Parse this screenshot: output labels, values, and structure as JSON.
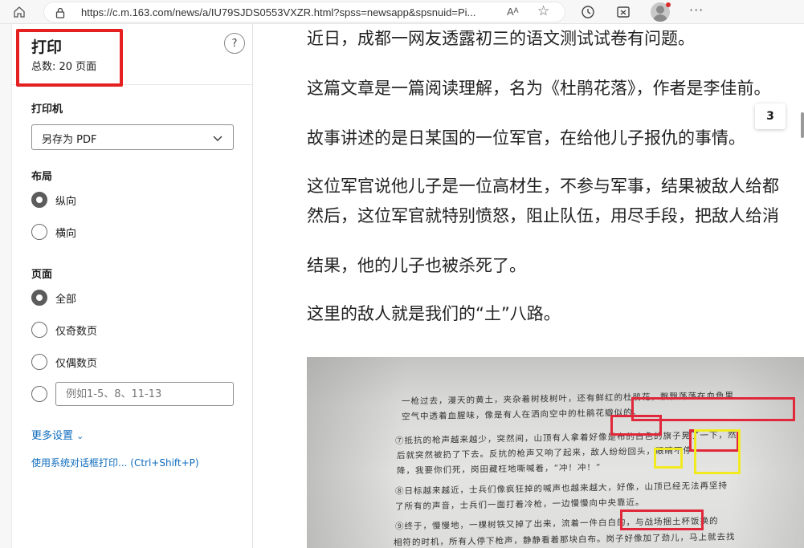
{
  "browser": {
    "url": "https://c.m.163.com/news/a/IU79SJDS0553VXZR.html?spss=newsapp&spsnuid=Pi...",
    "read_aloud_label": "Aᴬ",
    "more_label": "···"
  },
  "print_panel": {
    "title": "打印",
    "total_pages": "总数: 20 页面",
    "help_label": "?",
    "printer_label": "打印机",
    "printer_value": "另存为 PDF",
    "layout_label": "布局",
    "layout_options": [
      "纵向",
      "横向"
    ],
    "layout_selected": "纵向",
    "pages_label": "页面",
    "pages_options": [
      "全部",
      "仅奇数页",
      "仅偶数页"
    ],
    "pages_selected": "全部",
    "custom_range_placeholder": "例如1-5、8、11-13",
    "more_settings": "更多设置",
    "system_dialog": "使用系统对话框打印... (Ctrl+Shift+P)"
  },
  "article": {
    "paragraphs": [
      "近日，成都一网友透露初三的语文测试试卷有问题。",
      "这篇文章是一篇阅读理解，名为《杜鹃花落》，作者是李佳前。",
      "故事讲述的是日某国的一位军官，在给他儿子报仇的事情。",
      "这位军官说他儿子是一位高材生，不参与军事，结果被敌人给都",
      "然后，这位军官就特别愤怒，阻止队伍，用尽手段，把敌人给消",
      "结果，他的儿子也被杀死了。",
      "这里的敌人就是我们的“土”八路。"
    ],
    "page_badge": "3",
    "photo_lines": [
      "一枪过去，漫天的黄土，夹杂着树枝树叶，还有鲜红的杜鹃花，飘飘荡荡在血色里",
      "空气中透着血腥味，像是有人在洒向空中的杜鹃花瓣似的。",
      "⑦抵抗的枪声越来越少，突然间，山顶有人拿着好像是布的白色的旗子晃了一下，然",
      "后就突然被扔了下去。反抗的枪声又响了起来，敌人纷纷回头，眼睛不停",
      "降，我要你们死，岗田藏枉地嘶喊着，“冲！冲！”",
      "⑧日标越来越近，士兵们像疯狂掉的喊声也越来越大，好像，山顶已经无法再坚持",
      "了所有的声音，士兵们一面打着冷枪，一边慢慢向中央靠近。",
      "⑨终于，慢慢地，一棵树铁又掉了出来，流着一件白白的，与战场捆土杯饭换的",
      "相符的时机，所有人停下枪声，静静看着那块白布。岗子好像加了劲儿，马上就去找"
    ]
  }
}
